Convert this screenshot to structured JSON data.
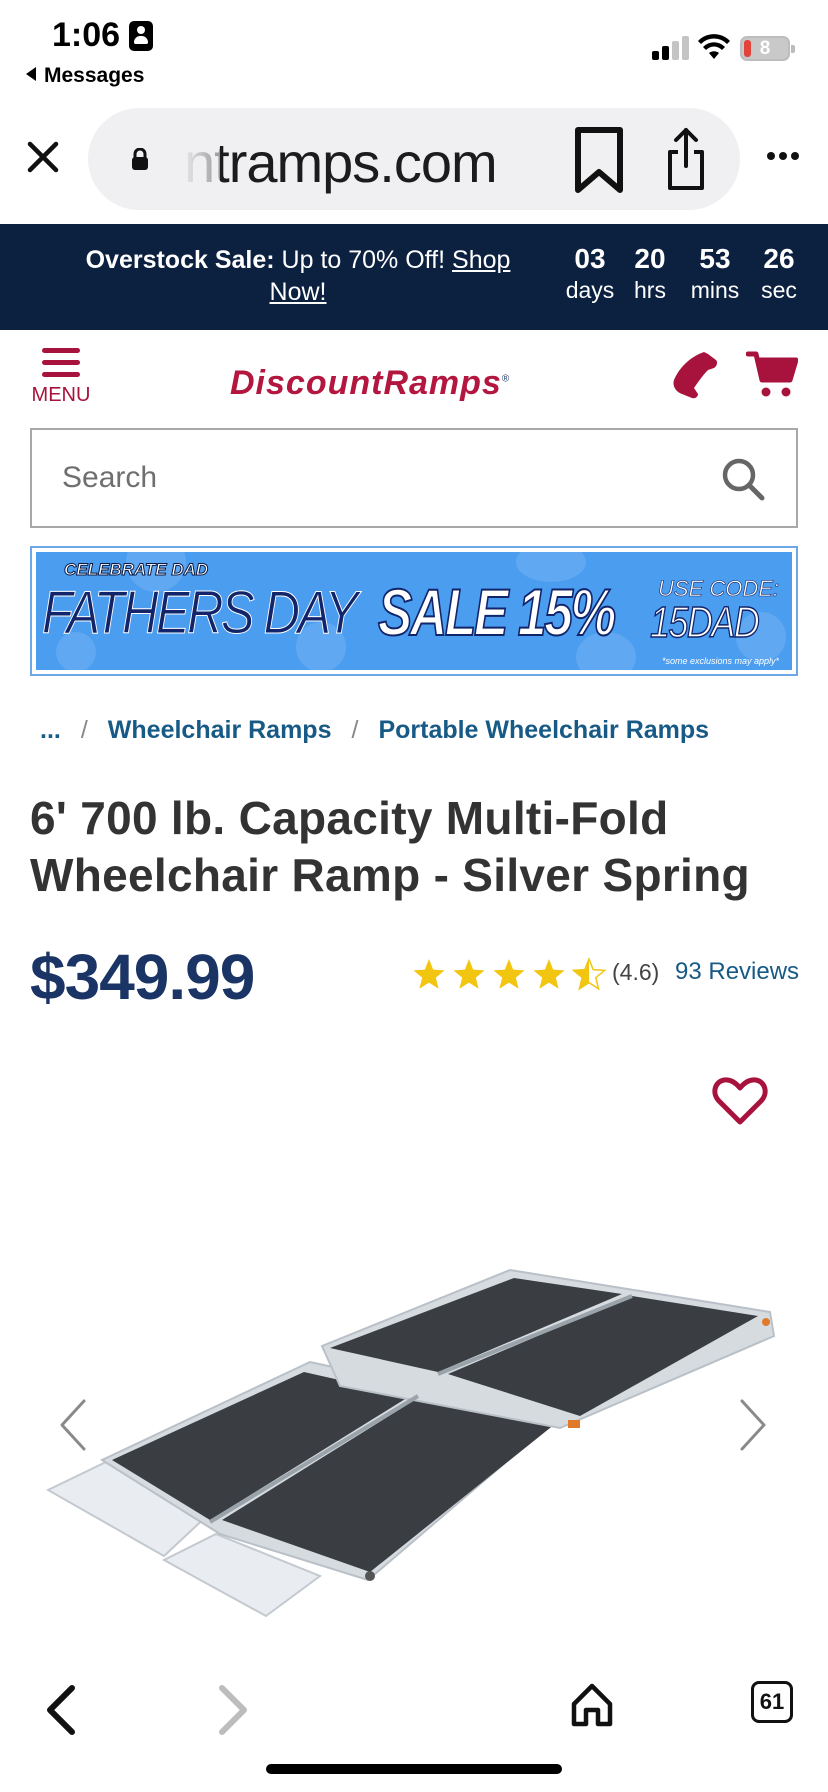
{
  "status_bar": {
    "time": "1:06",
    "back_label": "Messages",
    "battery": "8"
  },
  "browser": {
    "url": "ntramps.com",
    "tab_count": "61"
  },
  "promo": {
    "label": "Overstock Sale:",
    "text": "Up to 70% Off!",
    "link": "Shop Now!",
    "countdown": [
      {
        "value": "03",
        "unit": "days"
      },
      {
        "value": "20",
        "unit": "hrs"
      },
      {
        "value": "53",
        "unit": "mins"
      },
      {
        "value": "26",
        "unit": "sec"
      }
    ]
  },
  "header": {
    "menu_label": "MENU",
    "logo_part1": "DiscountRamps",
    "logo_part2": "",
    "logo_mark": "®",
    "brand_color": "#a8133e",
    "navy_color": "#1a3565"
  },
  "search": {
    "placeholder": "Search"
  },
  "banner": {
    "celebrate": "CELEBRATE DAD",
    "fathers_day": "FATHERS DAY",
    "sale": "SALE 15%",
    "use_code": "USE CODE:",
    "code": "15DAD",
    "exclusions": "*some exclusions may apply*"
  },
  "breadcrumb": {
    "ellipsis": "...",
    "items": [
      "Wheelchair Ramps",
      "Portable Wheelchair Ramps"
    ]
  },
  "product": {
    "title": "6' 700 lb. Capacity Multi-Fold Wheelchair Ramp - Silver Spring",
    "price": "$349.99",
    "rating": 4.6,
    "rating_text": "(4.6)",
    "reviews": "93 Reviews"
  },
  "icons": {
    "close": "close-icon",
    "lock": "lock-icon",
    "bookmark": "bookmark-icon",
    "share": "share-icon",
    "more": "more-icon",
    "phone": "phone-icon",
    "cart": "cart-icon",
    "search": "search-icon",
    "wishlist": "heart-icon",
    "prev": "chevron-left-icon",
    "next": "chevron-right-icon",
    "home": "home-icon"
  }
}
